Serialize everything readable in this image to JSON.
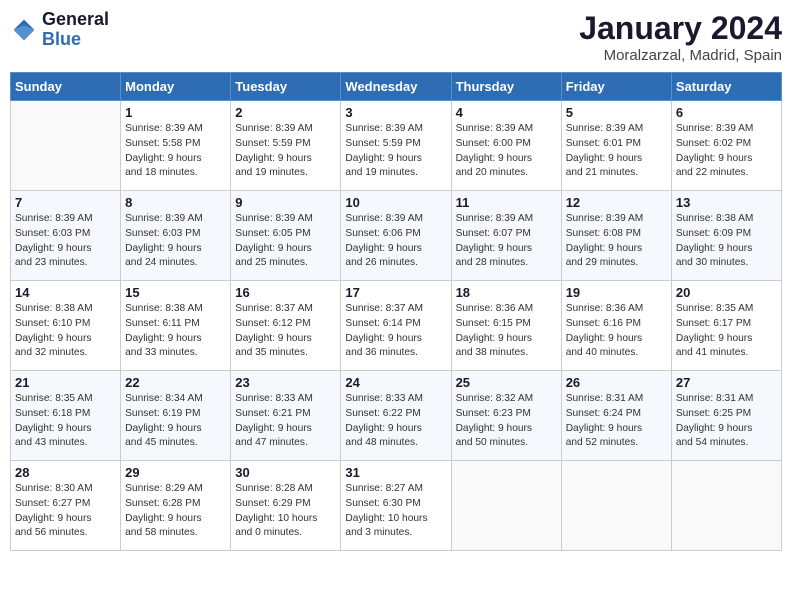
{
  "logo": {
    "line1": "General",
    "line2": "Blue"
  },
  "title": "January 2024",
  "location": "Moralzarzal, Madrid, Spain",
  "days_of_week": [
    "Sunday",
    "Monday",
    "Tuesday",
    "Wednesday",
    "Thursday",
    "Friday",
    "Saturday"
  ],
  "weeks": [
    [
      {
        "day": "",
        "info": ""
      },
      {
        "day": "1",
        "info": "Sunrise: 8:39 AM\nSunset: 5:58 PM\nDaylight: 9 hours\nand 18 minutes."
      },
      {
        "day": "2",
        "info": "Sunrise: 8:39 AM\nSunset: 5:59 PM\nDaylight: 9 hours\nand 19 minutes."
      },
      {
        "day": "3",
        "info": "Sunrise: 8:39 AM\nSunset: 5:59 PM\nDaylight: 9 hours\nand 19 minutes."
      },
      {
        "day": "4",
        "info": "Sunrise: 8:39 AM\nSunset: 6:00 PM\nDaylight: 9 hours\nand 20 minutes."
      },
      {
        "day": "5",
        "info": "Sunrise: 8:39 AM\nSunset: 6:01 PM\nDaylight: 9 hours\nand 21 minutes."
      },
      {
        "day": "6",
        "info": "Sunrise: 8:39 AM\nSunset: 6:02 PM\nDaylight: 9 hours\nand 22 minutes."
      }
    ],
    [
      {
        "day": "7",
        "info": ""
      },
      {
        "day": "8",
        "info": "Sunrise: 8:39 AM\nSunset: 6:03 PM\nDaylight: 9 hours\nand 24 minutes."
      },
      {
        "day": "9",
        "info": "Sunrise: 8:39 AM\nSunset: 6:05 PM\nDaylight: 9 hours\nand 25 minutes."
      },
      {
        "day": "10",
        "info": "Sunrise: 8:39 AM\nSunset: 6:06 PM\nDaylight: 9 hours\nand 26 minutes."
      },
      {
        "day": "11",
        "info": "Sunrise: 8:39 AM\nSunset: 6:07 PM\nDaylight: 9 hours\nand 28 minutes."
      },
      {
        "day": "12",
        "info": "Sunrise: 8:39 AM\nSunset: 6:08 PM\nDaylight: 9 hours\nand 29 minutes."
      },
      {
        "day": "13",
        "info": "Sunrise: 8:38 AM\nSunset: 6:09 PM\nDaylight: 9 hours\nand 30 minutes."
      }
    ],
    [
      {
        "day": "14",
        "info": ""
      },
      {
        "day": "15",
        "info": "Sunrise: 8:38 AM\nSunset: 6:11 PM\nDaylight: 9 hours\nand 33 minutes."
      },
      {
        "day": "16",
        "info": "Sunrise: 8:37 AM\nSunset: 6:12 PM\nDaylight: 9 hours\nand 35 minutes."
      },
      {
        "day": "17",
        "info": "Sunrise: 8:37 AM\nSunset: 6:14 PM\nDaylight: 9 hours\nand 36 minutes."
      },
      {
        "day": "18",
        "info": "Sunrise: 8:36 AM\nSunset: 6:15 PM\nDaylight: 9 hours\nand 38 minutes."
      },
      {
        "day": "19",
        "info": "Sunrise: 8:36 AM\nSunset: 6:16 PM\nDaylight: 9 hours\nand 40 minutes."
      },
      {
        "day": "20",
        "info": "Sunrise: 8:35 AM\nSunset: 6:17 PM\nDaylight: 9 hours\nand 41 minutes."
      }
    ],
    [
      {
        "day": "21",
        "info": ""
      },
      {
        "day": "22",
        "info": "Sunrise: 8:34 AM\nSunset: 6:19 PM\nDaylight: 9 hours\nand 45 minutes."
      },
      {
        "day": "23",
        "info": "Sunrise: 8:33 AM\nSunset: 6:21 PM\nDaylight: 9 hours\nand 47 minutes."
      },
      {
        "day": "24",
        "info": "Sunrise: 8:33 AM\nSunset: 6:22 PM\nDaylight: 9 hours\nand 48 minutes."
      },
      {
        "day": "25",
        "info": "Sunrise: 8:32 AM\nSunset: 6:23 PM\nDaylight: 9 hours\nand 50 minutes."
      },
      {
        "day": "26",
        "info": "Sunrise: 8:31 AM\nSunset: 6:24 PM\nDaylight: 9 hours\nand 52 minutes."
      },
      {
        "day": "27",
        "info": "Sunrise: 8:31 AM\nSunset: 6:25 PM\nDaylight: 9 hours\nand 54 minutes."
      }
    ],
    [
      {
        "day": "28",
        "info": "Sunrise: 8:30 AM\nSunset: 6:27 PM\nDaylight: 9 hours\nand 56 minutes."
      },
      {
        "day": "29",
        "info": "Sunrise: 8:29 AM\nSunset: 6:28 PM\nDaylight: 9 hours\nand 58 minutes."
      },
      {
        "day": "30",
        "info": "Sunrise: 8:28 AM\nSunset: 6:29 PM\nDaylight: 10 hours\nand 0 minutes."
      },
      {
        "day": "31",
        "info": "Sunrise: 8:27 AM\nSunset: 6:30 PM\nDaylight: 10 hours\nand 3 minutes."
      },
      {
        "day": "",
        "info": ""
      },
      {
        "day": "",
        "info": ""
      },
      {
        "day": "",
        "info": ""
      }
    ]
  ],
  "week2_sunday": "Sunrise: 8:39 AM\nSunset: 6:03 PM\nDaylight: 9 hours\nand 23 minutes.",
  "week3_sunday": "Sunrise: 8:38 AM\nSunset: 6:10 PM\nDaylight: 9 hours\nand 32 minutes.",
  "week4_sunday": "Sunrise: 8:35 AM\nSunset: 6:18 PM\nDaylight: 9 hours\nand 43 minutes."
}
